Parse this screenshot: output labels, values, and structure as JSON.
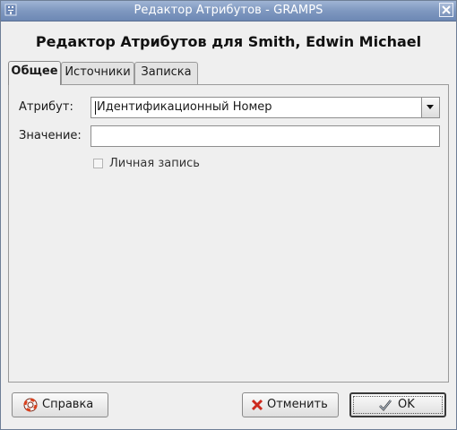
{
  "window": {
    "title": "Редактор Атрибутов - GRAMPS"
  },
  "heading": "Редактор Атрибутов для Smith, Edwin Michael",
  "tabs": [
    {
      "label": "Общее",
      "active": true
    },
    {
      "label": "Источники",
      "active": false
    },
    {
      "label": "Записка",
      "active": false
    }
  ],
  "form": {
    "attribute_label": "Атрибут:",
    "attribute_value": "Идентификационный Номер",
    "value_label": "Значение:",
    "value_value": "",
    "private_label": "Личная запись",
    "private_checked": false
  },
  "buttons": {
    "help": "Справка",
    "cancel": "Отменить",
    "ok": "OK"
  },
  "icons": {
    "app": "gramps-app-icon",
    "close": "close-icon",
    "dropdown": "triangle-down-icon",
    "help": "lifebuoy-icon",
    "cancel": "red-x-icon",
    "ok": "checkmark-hand-icon"
  },
  "colors": {
    "titlebar": "#7f98c0",
    "dialog_bg": "#efefef",
    "cancel_icon": "#cc2a1e",
    "help_icon": "#d9411e"
  }
}
